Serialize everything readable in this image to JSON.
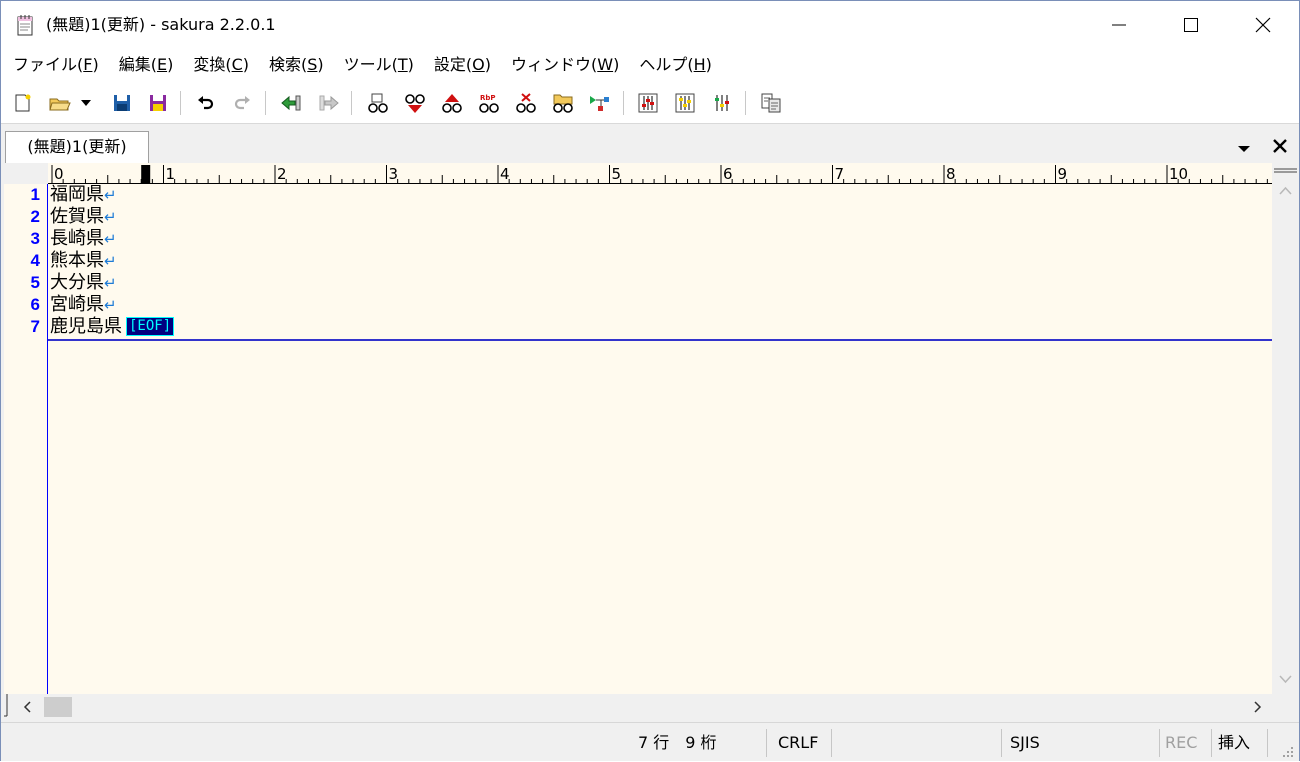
{
  "window": {
    "title": "(無題)1(更新) - sakura 2.2.0.1"
  },
  "menu": [
    {
      "label": "ファイル(",
      "key": "F",
      "end": ")"
    },
    {
      "label": "編集(",
      "key": "E",
      "end": ")"
    },
    {
      "label": "変換(",
      "key": "C",
      "end": ")"
    },
    {
      "label": "検索(",
      "key": "S",
      "end": ")"
    },
    {
      "label": "ツール(",
      "key": "T",
      "end": ")"
    },
    {
      "label": "設定(",
      "key": "O",
      "end": ")"
    },
    {
      "label": "ウィンドウ(",
      "key": "W",
      "end": ")"
    },
    {
      "label": "ヘルプ(",
      "key": "H",
      "end": ")"
    }
  ],
  "tab": {
    "label": "(無題)1(更新)"
  },
  "ruler": {
    "labels": [
      "0",
      "1",
      "2",
      "3",
      "4",
      "5",
      "6",
      "7",
      "8",
      "9",
      "10"
    ]
  },
  "editor": {
    "lines": [
      {
        "no": "1",
        "text": "福岡県",
        "eol": "↵"
      },
      {
        "no": "2",
        "text": "佐賀県",
        "eol": "↵"
      },
      {
        "no": "3",
        "text": "長崎県",
        "eol": "↵"
      },
      {
        "no": "4",
        "text": "熊本県",
        "eol": "↵"
      },
      {
        "no": "5",
        "text": "大分県",
        "eol": "↵"
      },
      {
        "no": "6",
        "text": "宮崎県",
        "eol": "↵"
      },
      {
        "no": "7",
        "text": "鹿児島県",
        "eol": "[EOF]"
      }
    ]
  },
  "status": {
    "position": "7 行　9 桁",
    "eol": "CRLF",
    "encoding": "SJIS",
    "rec": "REC",
    "mode": "挿入"
  },
  "colors": {
    "editor_bg": "#fffaee",
    "line_number": "#0000ff",
    "eol_mark": "#1e7bd6",
    "eof_bg": "#000080",
    "eof_fg": "#00ffff"
  }
}
